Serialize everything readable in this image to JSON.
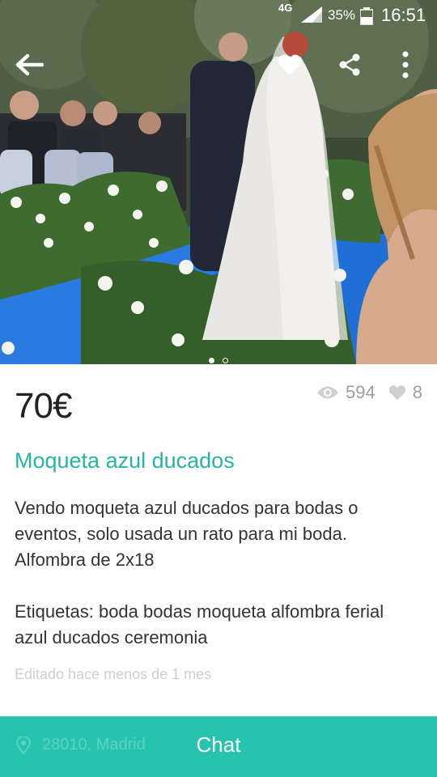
{
  "status_bar": {
    "network": "4G",
    "battery": "35%",
    "time": "16:51"
  },
  "product": {
    "price": "70€",
    "views": "594",
    "likes": "8",
    "title": "Moqueta azul ducados",
    "description_lines": [
      "Vendo moqueta azul ducados para bodas o eventos, solo usada un rato para mi boda.",
      "Alfombra de 2x18"
    ],
    "tags": "Etiquetas: boda bodas moqueta alfombra ferial azul ducados ceremonia",
    "edited": "Editado hace menos de 1 mes",
    "image_count": 2,
    "image_index": 1
  },
  "bottom_bar": {
    "location": "28010, Madrid",
    "chat_label": "Chat"
  },
  "colors": {
    "accent": "#26b5a5",
    "chat_bar": "#26c3ad",
    "carpet_blue": "#1f6fd6"
  },
  "icons": [
    "back-arrow-icon",
    "heart-icon",
    "share-icon",
    "more-vertical-icon",
    "eye-icon",
    "heart-count-icon",
    "location-pin-icon"
  ]
}
